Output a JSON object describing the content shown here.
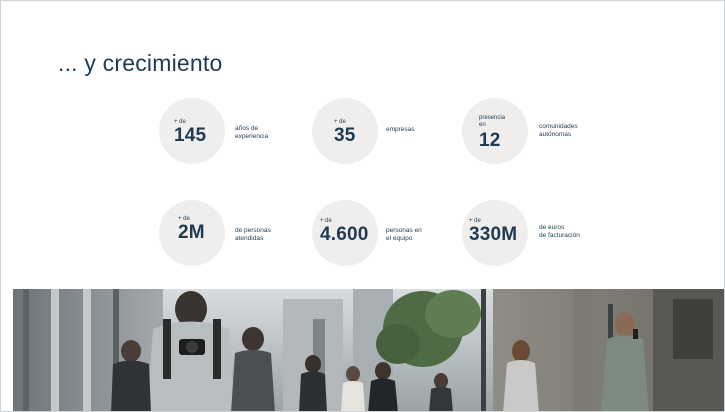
{
  "slide": {
    "title": "... y crecimiento"
  },
  "stats": [
    {
      "prefix": "+ de",
      "value": "145",
      "description": "años de\nexperiencia"
    },
    {
      "prefix": "+ de",
      "value": "35",
      "description": "empresas"
    },
    {
      "prefix": "presencia\nen",
      "value": "12",
      "description": "comunidades\nautónomas"
    },
    {
      "prefix": "+ de",
      "value": "2M",
      "description": "de personas\natendidas"
    },
    {
      "prefix": "+ de",
      "value": "4.600",
      "description": "personas en\nel equipo"
    },
    {
      "prefix": "+ de",
      "value": "330M",
      "description": "de euros\nde facturación"
    }
  ],
  "colors": {
    "title": "#1f3b52",
    "circle": "#efeeed",
    "border": "#cfd4d8"
  },
  "photo": {
    "icon": "street-crowd-photo"
  }
}
